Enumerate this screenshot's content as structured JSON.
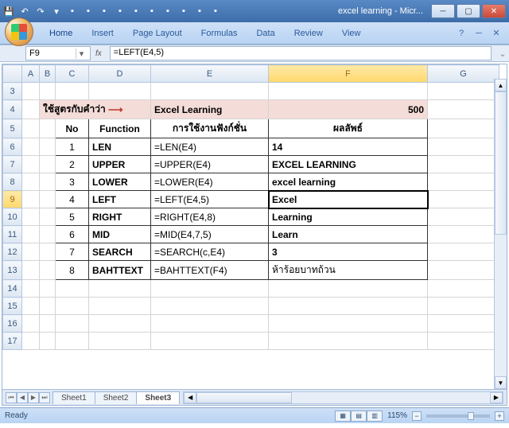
{
  "window": {
    "title": "excel learning - Micr..."
  },
  "ribbon": {
    "tabs": [
      "Home",
      "Insert",
      "Page Layout",
      "Formulas",
      "Data",
      "Review",
      "View"
    ]
  },
  "namebox": "F9",
  "formula": "=LEFT(E4,5)",
  "fx_label": "fx",
  "columns": [
    "A",
    "B",
    "C",
    "D",
    "E",
    "F",
    "G"
  ],
  "rows": [
    "3",
    "4",
    "5",
    "6",
    "7",
    "8",
    "9",
    "10",
    "11",
    "12",
    "13",
    "14",
    "15",
    "16",
    "17"
  ],
  "selected_row": "9",
  "selected_col": "F",
  "row4": {
    "label": "ใช้สูตรกับคำว่า",
    "e": "Excel Learning",
    "f": "500"
  },
  "headers": {
    "c": "No",
    "d": "Function",
    "e": "การใช้งานฟังก์ชั่น",
    "f": "ผลลัพธ์"
  },
  "data_rows": [
    {
      "no": "1",
      "fn": "LEN",
      "usage": "=LEN(E4)",
      "result": "14"
    },
    {
      "no": "2",
      "fn": "UPPER",
      "usage": "=UPPER(E4)",
      "result": "EXCEL LEARNING"
    },
    {
      "no": "3",
      "fn": "LOWER",
      "usage": "=LOWER(E4)",
      "result": "excel learning"
    },
    {
      "no": "4",
      "fn": "LEFT",
      "usage": "=LEFT(E4,5)",
      "result": "Excel"
    },
    {
      "no": "5",
      "fn": "RIGHT",
      "usage": "=RIGHT(E4,8)",
      "result": "Learning"
    },
    {
      "no": "6",
      "fn": "MID",
      "usage": "=MID(E4,7,5)",
      "result": "Learn"
    },
    {
      "no": "7",
      "fn": "SEARCH",
      "usage": "=SEARCH(c,E4)",
      "result": "3"
    },
    {
      "no": "8",
      "fn": "BAHTTEXT",
      "usage": "=BAHTTEXT(F4)",
      "result": "ห้าร้อยบาทถ้วน"
    }
  ],
  "sheet_tabs": [
    "Sheet1",
    "Sheet2",
    "Sheet3"
  ],
  "active_sheet": "Sheet3",
  "status": "Ready",
  "zoom": "115%"
}
